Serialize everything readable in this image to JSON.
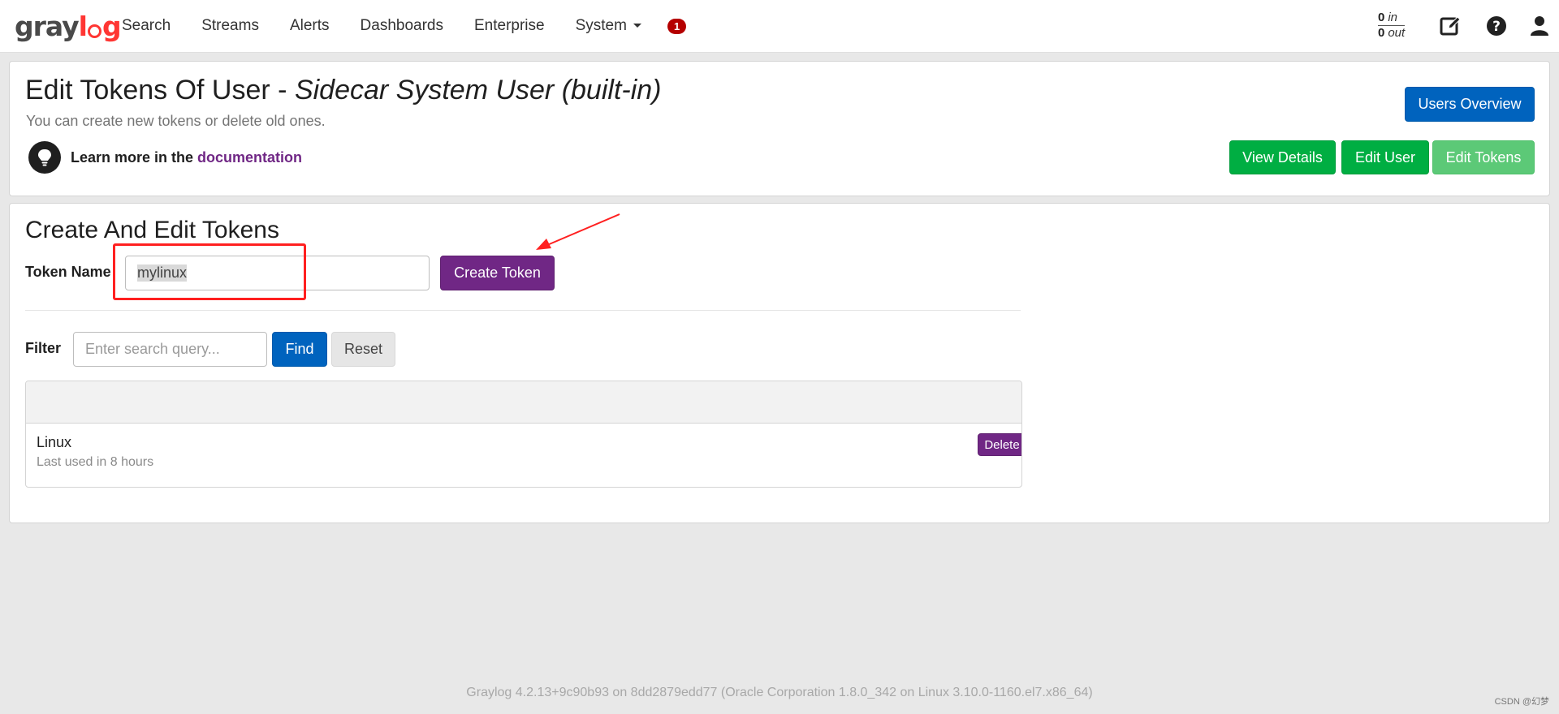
{
  "nav": {
    "logo_part1": "gray",
    "logo_part2": "log",
    "items": [
      "Search",
      "Streams",
      "Alerts",
      "Dashboards",
      "Enterprise"
    ],
    "system_label": "System",
    "notification_count": "1",
    "throughput": {
      "in_value": "0",
      "in_label": "in",
      "out_value": "0",
      "out_label": "out"
    },
    "icons": [
      "edit-icon",
      "help-icon",
      "user-icon"
    ]
  },
  "header": {
    "title_prefix": "Edit Tokens Of User - ",
    "title_user": "Sidecar System User (built-in)",
    "subtitle": "You can create new tokens or delete old ones.",
    "learn_prefix": "Learn more in the ",
    "learn_link": "documentation",
    "buttons": {
      "users_overview": "Users Overview",
      "view_details": "View Details",
      "edit_user": "Edit User",
      "edit_tokens": "Edit Tokens"
    }
  },
  "create": {
    "title": "Create And Edit Tokens",
    "token_label": "Token Name",
    "token_value": "mylinux",
    "create_button": "Create Token"
  },
  "filter": {
    "label": "Filter",
    "placeholder": "Enter search query...",
    "find_button": "Find",
    "reset_button": "Reset"
  },
  "tokens": [
    {
      "name": "Linux",
      "last_used": "Last used in 8 hours",
      "delete_label": "Delete"
    }
  ],
  "footer": "Graylog 4.2.13+9c90b93 on 8dd2879edd77 (Oracle Corporation 1.8.0_342 on Linux 3.10.0-1160.el7.x86_64)",
  "watermark": "CSDN @幻梦",
  "colors": {
    "accent_blue": "#0063be",
    "green": "#00ae42",
    "green_active": "#5cc977",
    "purple": "#702785",
    "badge_red": "#b50000",
    "annotation_red": "#ff2020"
  }
}
